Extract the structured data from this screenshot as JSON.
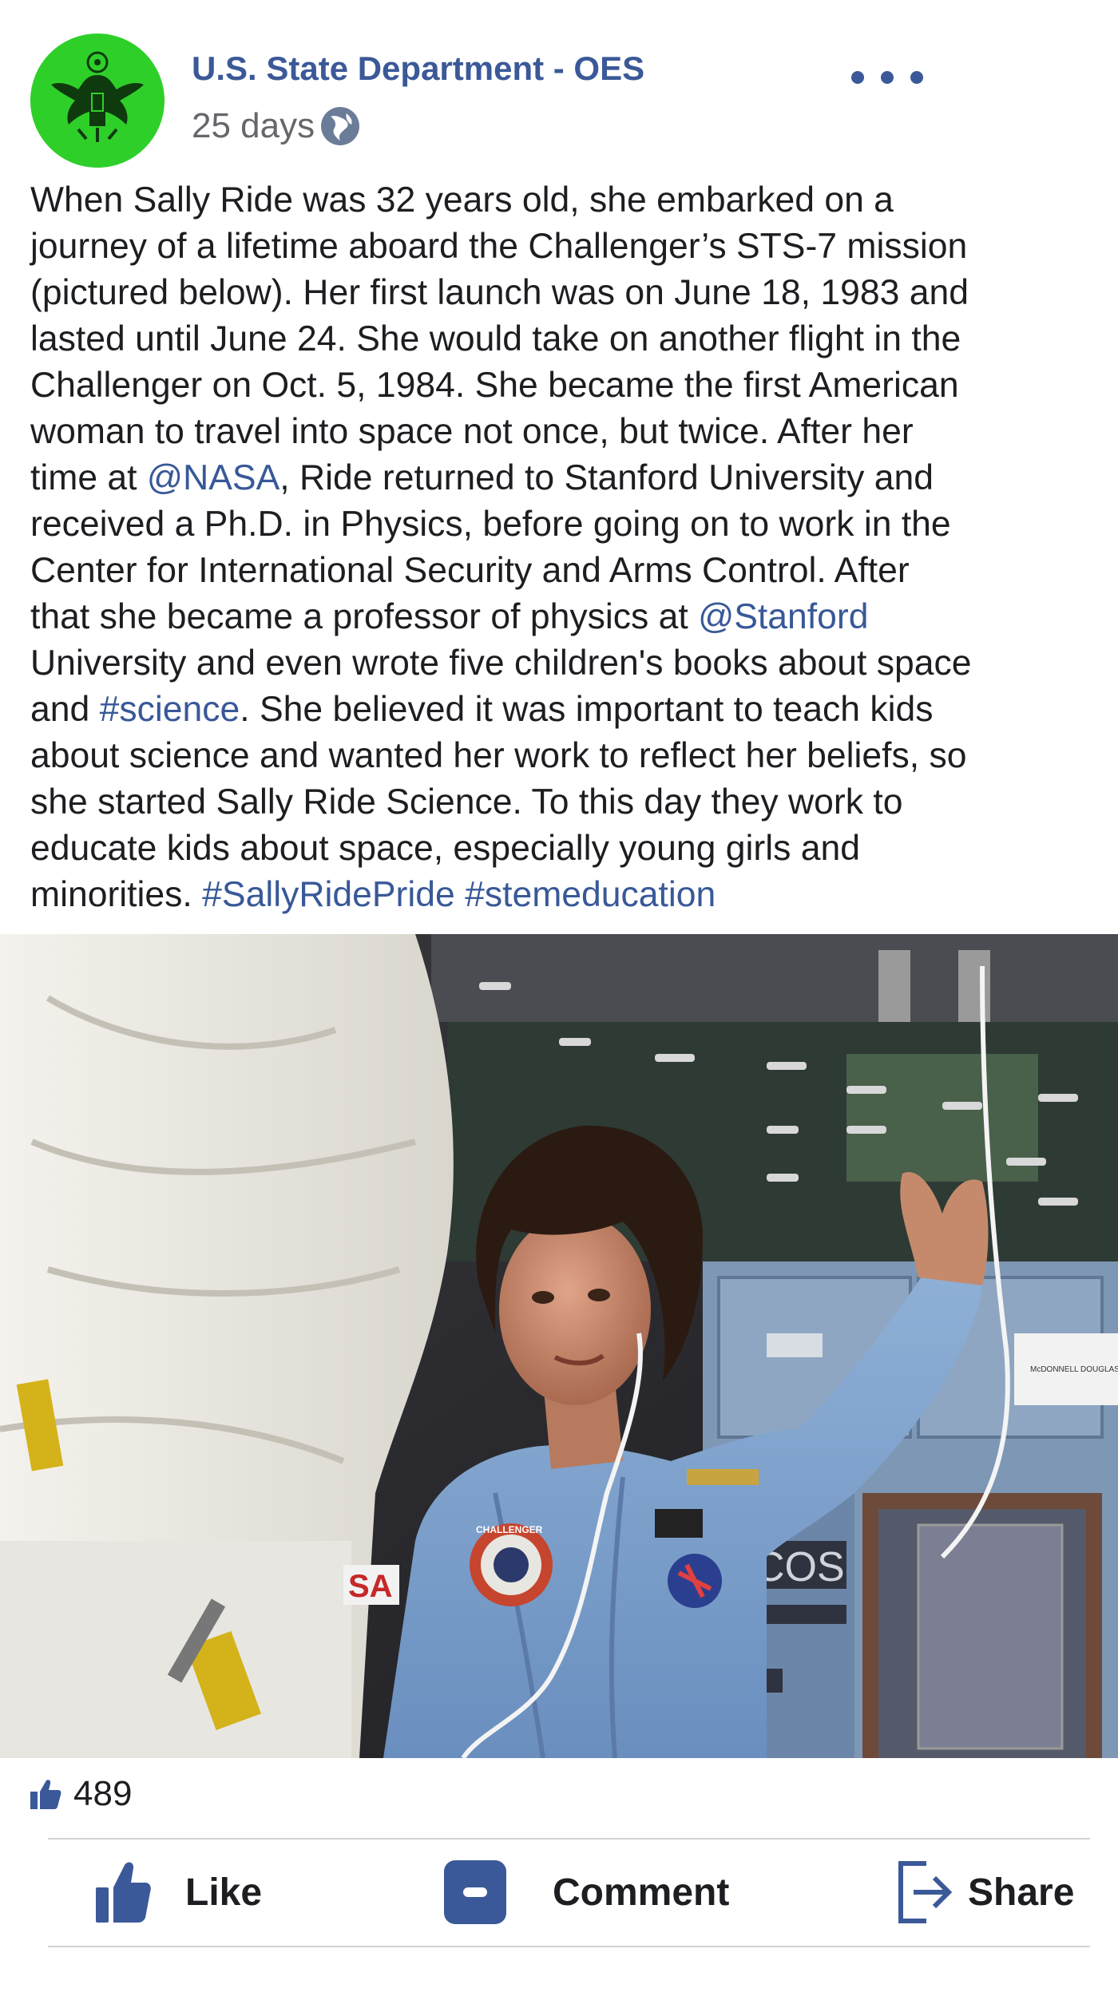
{
  "post": {
    "page_name": "U.S. State Department - OES",
    "timestamp": "25 days",
    "audience_icon": "globe-icon",
    "more_icon": "more-options-icon",
    "avatar": "state-department-seal",
    "text_lines": [
      [
        {
          "t": "When Sally Ride was 32 years old, she embarked on a"
        }
      ],
      [
        {
          "t": "journey of a lifetime aboard the Challenger’s STS-7 mission"
        }
      ],
      [
        {
          "t": "(pictured below). Her first launch was on June 18, 1983 and"
        }
      ],
      [
        {
          "t": "lasted until June 24. She would take on another flight in the"
        }
      ],
      [
        {
          "t": "Challenger on Oct. 5, 1984. She became the first American"
        }
      ],
      [
        {
          "t": "woman to travel into space not once, but twice. After her"
        }
      ],
      [
        {
          "t": "time at "
        },
        {
          "t": "@NASA",
          "link": true
        },
        {
          "t": ", Ride returned to Stanford University and"
        }
      ],
      [
        {
          "t": "received a Ph.D. in Physics, before going on to work in the"
        }
      ],
      [
        {
          "t": "Center for International Security and Arms Control. After"
        }
      ],
      [
        {
          "t": "that she became a professor of physics at "
        },
        {
          "t": "@Stanford",
          "link": true
        }
      ],
      [
        {
          "t": "University and even wrote five children's books about space"
        }
      ],
      [
        {
          "t": "and "
        },
        {
          "t": "#science",
          "link": true
        },
        {
          "t": ". She believed it was important to teach kids"
        }
      ],
      [
        {
          "t": "about science and wanted her work to reflect her beliefs, so"
        }
      ],
      [
        {
          "t": "she started Sally Ride Science. To this day they work to"
        }
      ],
      [
        {
          "t": "educate kids about space, especially young girls and"
        }
      ],
      [
        {
          "t": "minorities. "
        },
        {
          "t": "#SallyRidePride",
          "link": true
        },
        {
          "t": " "
        },
        {
          "t": "#stemeducation",
          "link": true
        }
      ]
    ],
    "photo": {
      "badge_text": "CHALLENGER",
      "sleeve_text": "SA",
      "panel_text": "COS",
      "logo_text": "McDONNELL DOUGLAS"
    }
  },
  "reactions": {
    "icon": "thumbs-up-icon",
    "count": "489"
  },
  "actions": {
    "like_label": "Like",
    "comment_label": "Comment",
    "share_label": "Share"
  },
  "colors": {
    "brand": "#3b5998",
    "link": "#385898",
    "avatar_bg": "#2fcf2a"
  }
}
